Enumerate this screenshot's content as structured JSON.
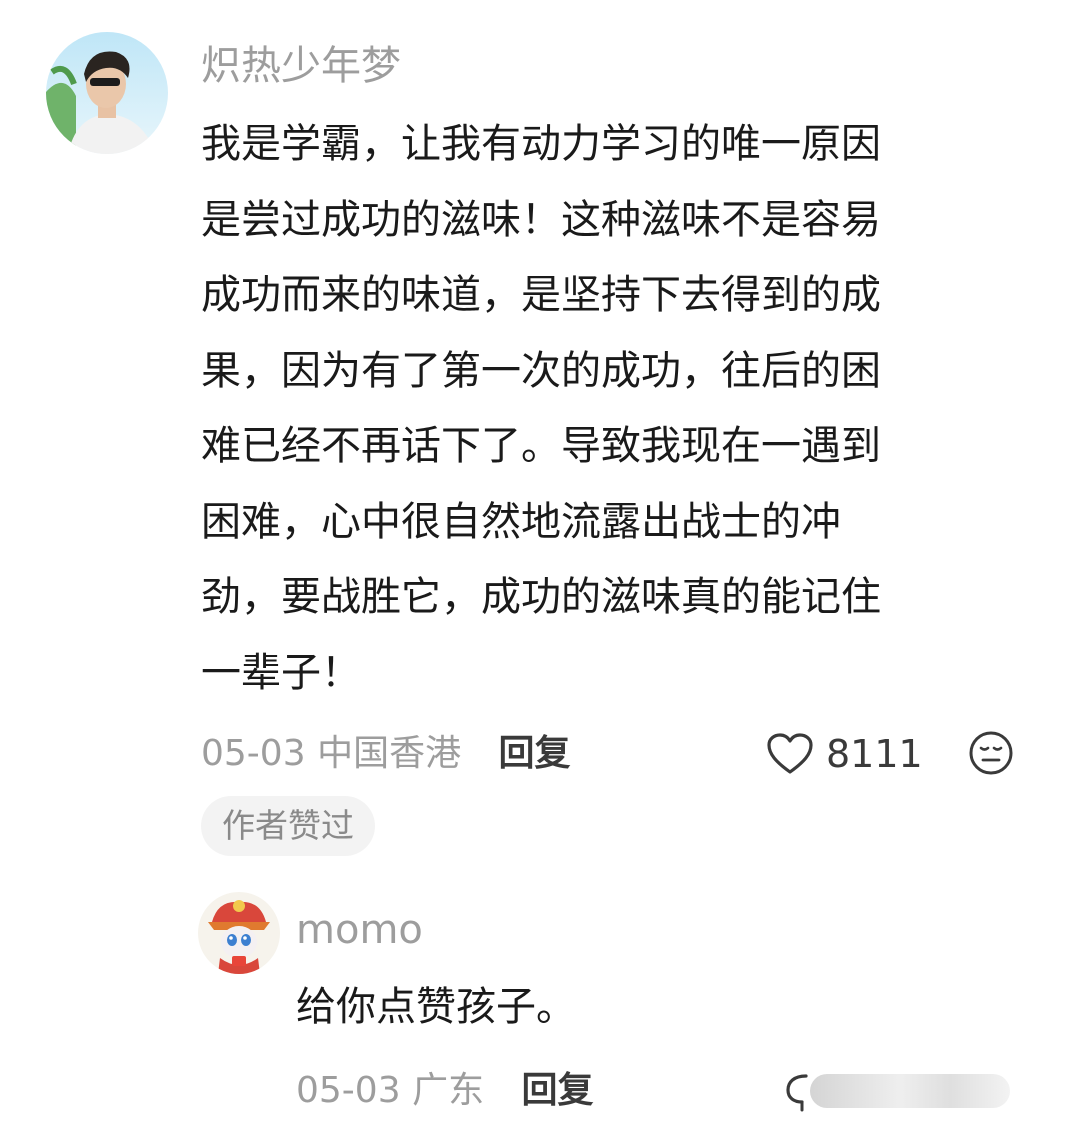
{
  "comment": {
    "username": "炽热少年梦",
    "lines": [
      "我是学霸，让我有动力学习的唯一原因",
      "是尝过成功的滋味！这种滋味不是容易",
      "成功而来的味道，是坚持下去得到的成",
      "果，因为有了第一次的成功，往后的困",
      "难已经不再话下了。导致我现在一遇到",
      "困难，心中很自然地流露出战士的冲",
      "劲，要战胜它，成功的滋味真的能记住",
      "一辈子！"
    ],
    "date": "05-03",
    "location": "中国香港",
    "reply_label": "回复",
    "like_count": "8111",
    "author_liked_badge": "作者赞过",
    "icons": {
      "avatar": "avatar-user-photo",
      "like": "heart-icon",
      "dislike": "dislike-face-icon"
    }
  },
  "reply": {
    "username": "momo",
    "text": "给你点赞孩子。",
    "date": "05-03",
    "location": "广东",
    "reply_label": "回复",
    "icons": {
      "avatar": "avatar-cartoon-lion-dance",
      "like": "heart-icon"
    }
  },
  "colors": {
    "meta_gray": "#9d9d9d",
    "text_dark": "#1a1a1a",
    "badge_bg": "#f3f3f3"
  }
}
